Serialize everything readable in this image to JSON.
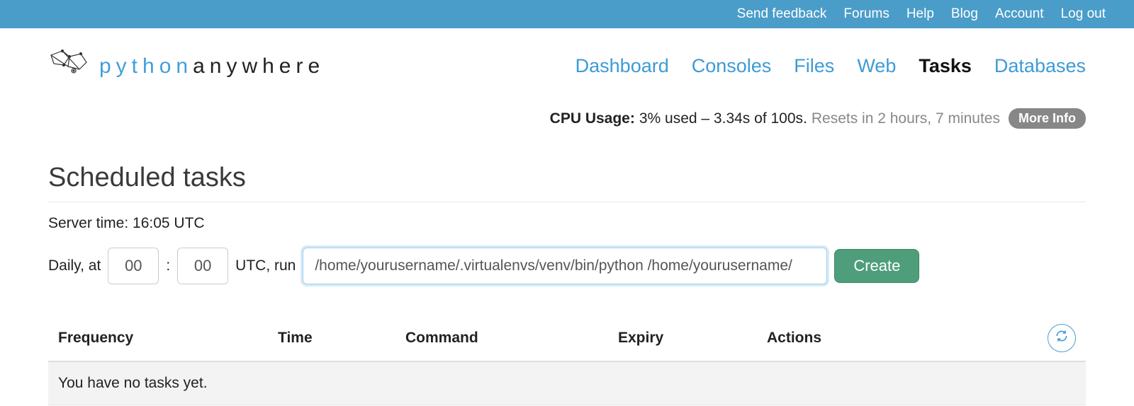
{
  "topbar": {
    "links": [
      "Send feedback",
      "Forums",
      "Help",
      "Blog",
      "Account",
      "Log out"
    ]
  },
  "logo": {
    "python": "python",
    "anywhere": "anywhere"
  },
  "nav": {
    "items": [
      {
        "label": "Dashboard",
        "active": false
      },
      {
        "label": "Consoles",
        "active": false
      },
      {
        "label": "Files",
        "active": false
      },
      {
        "label": "Web",
        "active": false
      },
      {
        "label": "Tasks",
        "active": true
      },
      {
        "label": "Databases",
        "active": false
      }
    ]
  },
  "cpu": {
    "label": "CPU Usage:",
    "used": "3% used – 3.34s of 100s.",
    "reset": "Resets in 2 hours, 7 minutes",
    "more": "More Info"
  },
  "page": {
    "title": "Scheduled tasks",
    "server_time_label": "Server time:",
    "server_time_value": "16:05 UTC"
  },
  "schedule": {
    "prefix": "Daily, at",
    "hour": "00",
    "colon": ":",
    "minute": "00",
    "suffix": "UTC, run",
    "command": "/home/yourusername/.virtualenvs/venv/bin/python /home/yourusername/",
    "create": "Create"
  },
  "table": {
    "headers": {
      "frequency": "Frequency",
      "time": "Time",
      "command": "Command",
      "expiry": "Expiry",
      "actions": "Actions"
    },
    "empty": "You have no tasks yet."
  }
}
